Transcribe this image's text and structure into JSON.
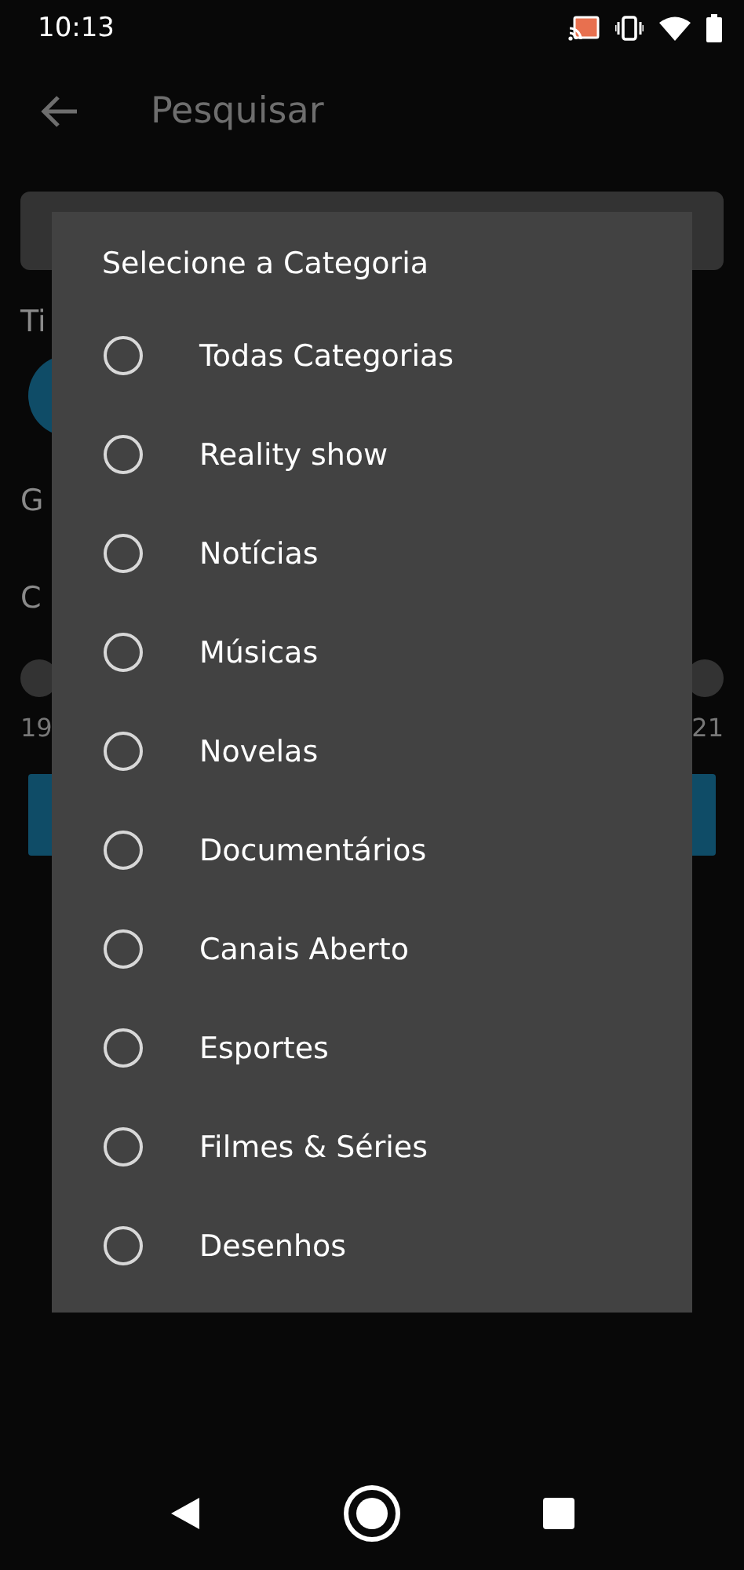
{
  "status_bar": {
    "time": "10:13"
  },
  "app_bar": {
    "title": "Pesquisar"
  },
  "background": {
    "type_label": "Ti",
    "genre_label": "G",
    "category_label": "C",
    "range_start": "19",
    "range_end": "21"
  },
  "dialog": {
    "title": "Selecione a Categoria",
    "options": [
      {
        "label": "Todas Categorias",
        "selected": false
      },
      {
        "label": "Reality show",
        "selected": false
      },
      {
        "label": "Notícias",
        "selected": false
      },
      {
        "label": "Músicas",
        "selected": false
      },
      {
        "label": "Novelas",
        "selected": false
      },
      {
        "label": "Documentários",
        "selected": false
      },
      {
        "label": "Canais Aberto",
        "selected": false
      },
      {
        "label": "Esportes",
        "selected": false
      },
      {
        "label": "Filmes & Séries",
        "selected": false
      },
      {
        "label": "Desenhos",
        "selected": false
      }
    ]
  }
}
